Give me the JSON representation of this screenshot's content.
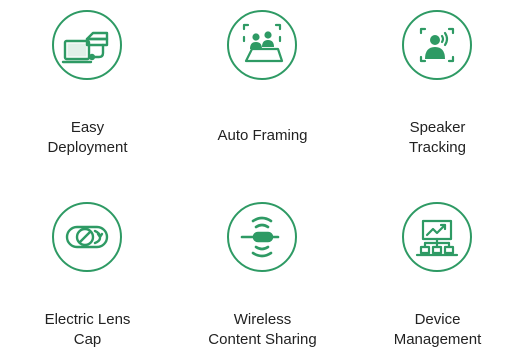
{
  "colors": {
    "accent": "#2e9a64",
    "text": "#222222",
    "background": "#ffffff"
  },
  "features": [
    {
      "label": "Easy\nDeployment",
      "icon": "pc-and-camera-icon"
    },
    {
      "label": "Auto Framing",
      "icon": "people-in-frame-icon"
    },
    {
      "label": "Speaker\nTracking",
      "icon": "speaking-person-icon"
    },
    {
      "label": "Electric Lens\nCap",
      "icon": "lens-cap-icon"
    },
    {
      "label": "Wireless\nContent Sharing",
      "icon": "wireless-dongle-icon"
    },
    {
      "label": "Device\nManagement",
      "icon": "monitoring-chart-icon"
    }
  ]
}
